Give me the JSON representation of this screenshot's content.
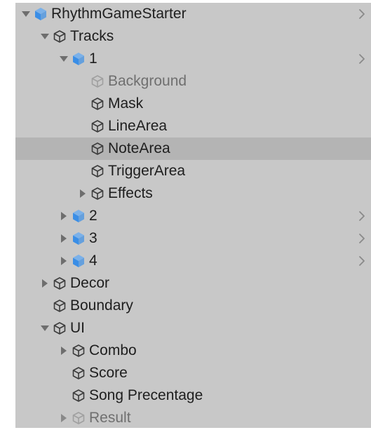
{
  "hierarchy": {
    "items": [
      {
        "label": "RhythmGameStarter",
        "depth": 0,
        "expanded": true,
        "hasChildren": true,
        "icon": "prefab-root-icon",
        "iconType": "blue",
        "disabled": false,
        "selected": false,
        "chevron": true
      },
      {
        "label": "Tracks",
        "depth": 1,
        "expanded": true,
        "hasChildren": true,
        "icon": "gameobject-icon",
        "iconType": "outline",
        "disabled": false,
        "selected": false,
        "chevron": false
      },
      {
        "label": "1",
        "depth": 2,
        "expanded": true,
        "hasChildren": true,
        "icon": "prefab-icon",
        "iconType": "blue",
        "disabled": false,
        "selected": false,
        "chevron": true
      },
      {
        "label": "Background",
        "depth": 3,
        "expanded": false,
        "hasChildren": false,
        "icon": "gameobject-icon",
        "iconType": "outline",
        "disabled": true,
        "selected": false,
        "chevron": false
      },
      {
        "label": "Mask",
        "depth": 3,
        "expanded": false,
        "hasChildren": false,
        "icon": "gameobject-icon",
        "iconType": "outline",
        "disabled": false,
        "selected": false,
        "chevron": false
      },
      {
        "label": "LineArea",
        "depth": 3,
        "expanded": false,
        "hasChildren": false,
        "icon": "gameobject-icon",
        "iconType": "outline",
        "disabled": false,
        "selected": false,
        "chevron": false
      },
      {
        "label": "NoteArea",
        "depth": 3,
        "expanded": false,
        "hasChildren": false,
        "icon": "gameobject-icon",
        "iconType": "outline",
        "disabled": false,
        "selected": true,
        "chevron": false
      },
      {
        "label": "TriggerArea",
        "depth": 3,
        "expanded": false,
        "hasChildren": false,
        "icon": "gameobject-icon",
        "iconType": "outline",
        "disabled": false,
        "selected": false,
        "chevron": false
      },
      {
        "label": "Effects",
        "depth": 3,
        "expanded": false,
        "hasChildren": true,
        "icon": "gameobject-icon",
        "iconType": "outline",
        "disabled": false,
        "selected": false,
        "chevron": false
      },
      {
        "label": "2",
        "depth": 2,
        "expanded": false,
        "hasChildren": true,
        "icon": "prefab-icon",
        "iconType": "blue",
        "disabled": false,
        "selected": false,
        "chevron": true
      },
      {
        "label": "3",
        "depth": 2,
        "expanded": false,
        "hasChildren": true,
        "icon": "prefab-icon",
        "iconType": "blue",
        "disabled": false,
        "selected": false,
        "chevron": true
      },
      {
        "label": "4",
        "depth": 2,
        "expanded": false,
        "hasChildren": true,
        "icon": "prefab-icon",
        "iconType": "blue",
        "disabled": false,
        "selected": false,
        "chevron": true
      },
      {
        "label": "Decor",
        "depth": 1,
        "expanded": false,
        "hasChildren": true,
        "icon": "gameobject-icon",
        "iconType": "outline",
        "disabled": false,
        "selected": false,
        "chevron": false
      },
      {
        "label": "Boundary",
        "depth": 1,
        "expanded": false,
        "hasChildren": false,
        "icon": "gameobject-icon",
        "iconType": "outline",
        "disabled": false,
        "selected": false,
        "chevron": false
      },
      {
        "label": "UI",
        "depth": 1,
        "expanded": true,
        "hasChildren": true,
        "icon": "gameobject-icon",
        "iconType": "outline",
        "disabled": false,
        "selected": false,
        "chevron": false
      },
      {
        "label": "Combo",
        "depth": 2,
        "expanded": false,
        "hasChildren": true,
        "icon": "gameobject-icon",
        "iconType": "outline",
        "disabled": false,
        "selected": false,
        "chevron": false
      },
      {
        "label": "Score",
        "depth": 2,
        "expanded": false,
        "hasChildren": false,
        "icon": "gameobject-icon",
        "iconType": "outline",
        "disabled": false,
        "selected": false,
        "chevron": false
      },
      {
        "label": "Song Precentage",
        "depth": 2,
        "expanded": false,
        "hasChildren": false,
        "icon": "gameobject-icon",
        "iconType": "outline",
        "disabled": false,
        "selected": false,
        "chevron": false
      },
      {
        "label": "Result",
        "depth": 2,
        "expanded": false,
        "hasChildren": true,
        "icon": "gameobject-icon",
        "iconType": "outline",
        "disabled": true,
        "selected": false,
        "chevron": false
      }
    ]
  },
  "colors": {
    "panel_background": "#c8c8c8",
    "selected_row": "#b4b4b4",
    "text": "#1e1e1e",
    "disabled_text": "#6f6f6f",
    "prefab_blue": "#3a8ee6",
    "outline_icon": "#3c3c3c",
    "disabled_icon": "#a0a0a0",
    "arrow": "#6e6e6e",
    "chevron": "#8a8a8a"
  }
}
